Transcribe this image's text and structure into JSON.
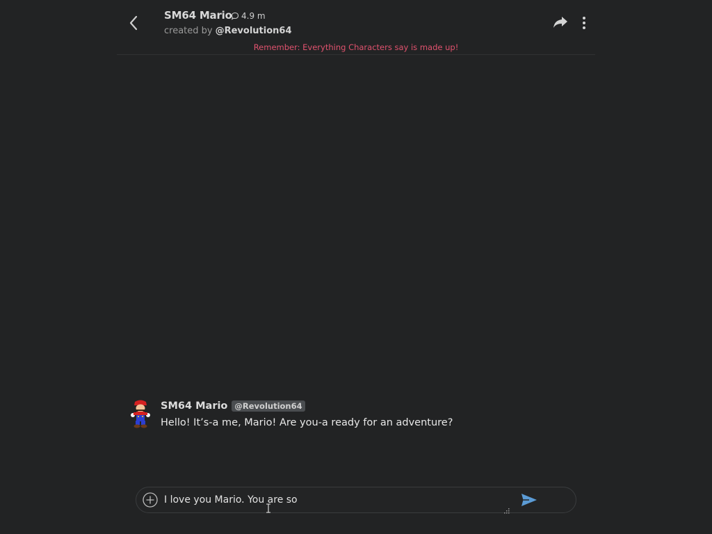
{
  "header": {
    "back_icon": "chevron-left-icon",
    "character_name": "SM64 Mario",
    "chat_count": "4.9 m",
    "chat_count_icon": "chat-bubble-icon",
    "created_by_label": "created by",
    "creator_handle": "@Revolution64",
    "share_icon": "share-arrow-icon",
    "more_icon": "more-vertical-icon",
    "disclaimer": "Remember: Everything Characters say is made up!"
  },
  "messages": [
    {
      "sender": "SM64 Mario",
      "badge": "@Revolution64",
      "avatar_icon": "mario-sprite-avatar",
      "text": "Hello! It’s-a me, Mario! Are you-a ready for an adventure?"
    }
  ],
  "composer": {
    "plus_icon": "plus-circle-icon",
    "value": "I love you Mario. You are so",
    "send_icon": "send-icon"
  },
  "colors": {
    "background": "#222324",
    "disclaimer": "#e0526e",
    "send": "#5b9bd5",
    "badge_bg": "#4a4d50"
  }
}
